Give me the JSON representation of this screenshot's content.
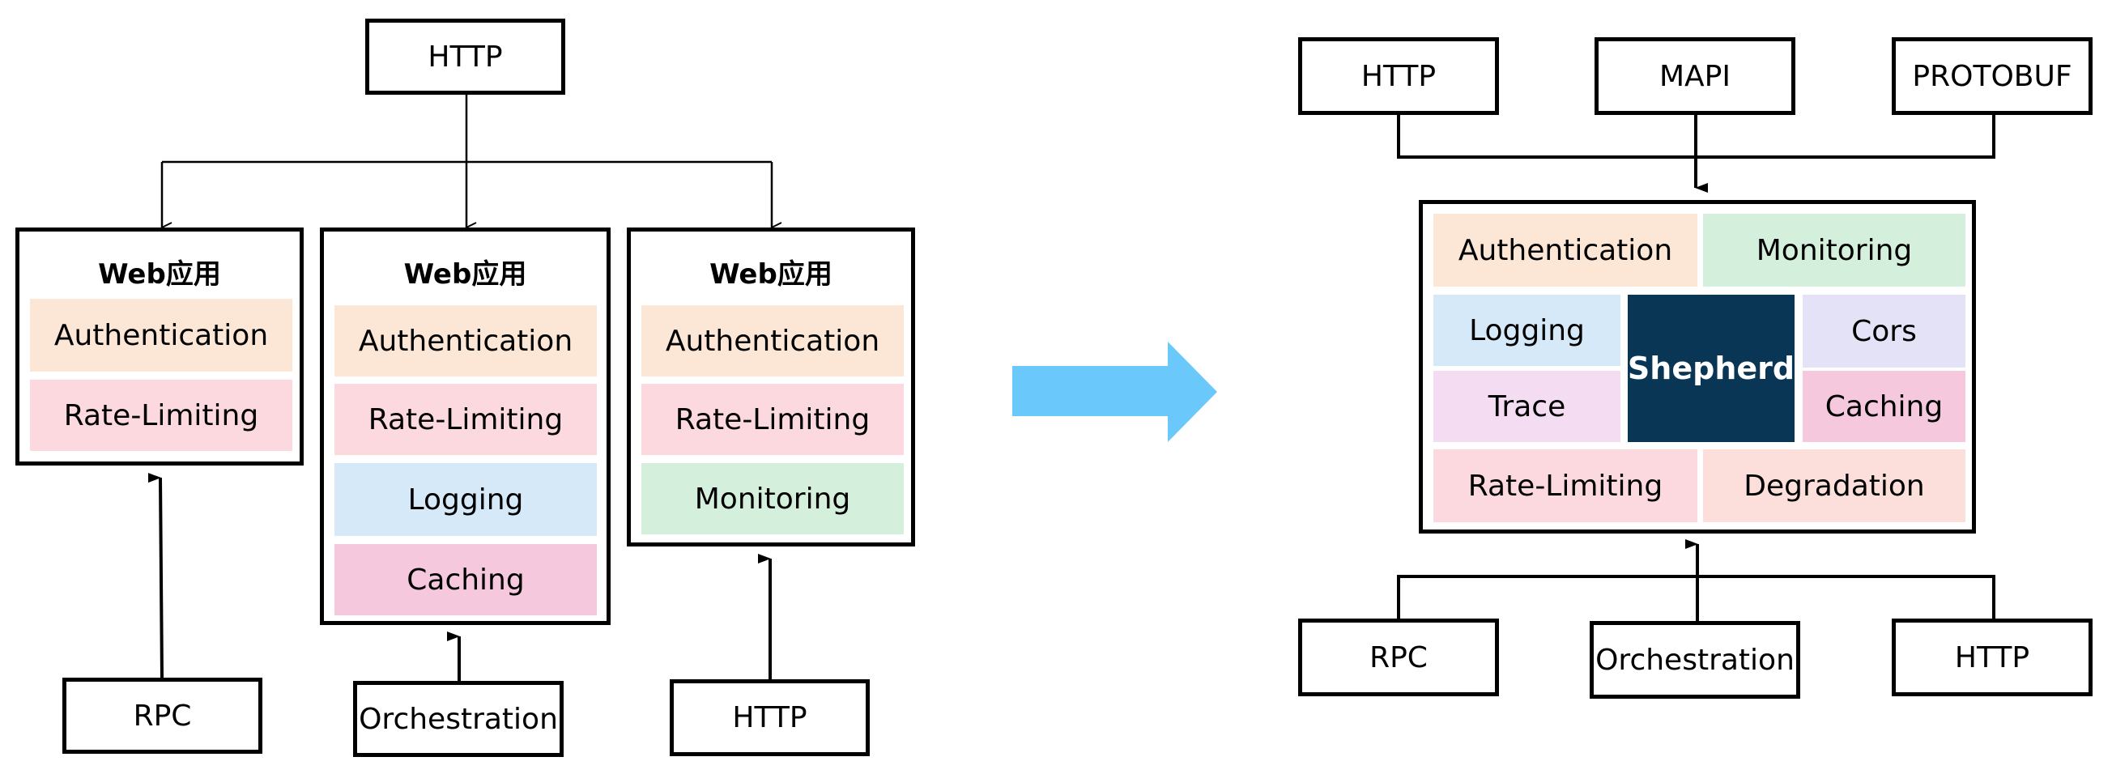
{
  "left": {
    "top_source": "HTTP",
    "apps": [
      {
        "title": "Web应用",
        "modules": [
          "Authentication",
          "Rate-Limiting"
        ],
        "source": "RPC"
      },
      {
        "title": "Web应用",
        "modules": [
          "Authentication",
          "Rate-Limiting",
          "Logging",
          "Caching"
        ],
        "source": "Orchestration"
      },
      {
        "title": "Web应用",
        "modules": [
          "Authentication",
          "Rate-Limiting",
          "Monitoring"
        ],
        "source": "HTTP"
      }
    ]
  },
  "transition_arrow": {
    "icon": "right-arrow-icon",
    "color": "#6bc8fb"
  },
  "right": {
    "top_sources": [
      "HTTP",
      "MAPI",
      "PROTOBUF"
    ],
    "gateway": {
      "core": "Shepherd",
      "modules": {
        "authentication": "Authentication",
        "monitoring": "Monitoring",
        "logging": "Logging",
        "trace": "Trace",
        "cors": "Cors",
        "caching": "Caching",
        "rate_limiting": "Rate-Limiting",
        "degradation": "Degradation"
      }
    },
    "bottom_sources": [
      "RPC",
      "Orchestration",
      "HTTP"
    ]
  },
  "colors": {
    "authentication": "#fce6d6",
    "rate_limiting": "#fcd9de",
    "logging": "#d5e9f9",
    "caching": "#f5c8dd",
    "monitoring": "#d4efdc",
    "cors": "#e4e2f6",
    "trace": "#f4dcf2",
    "degradation": "#fcdfda",
    "shepherd": "#0a3656"
  }
}
